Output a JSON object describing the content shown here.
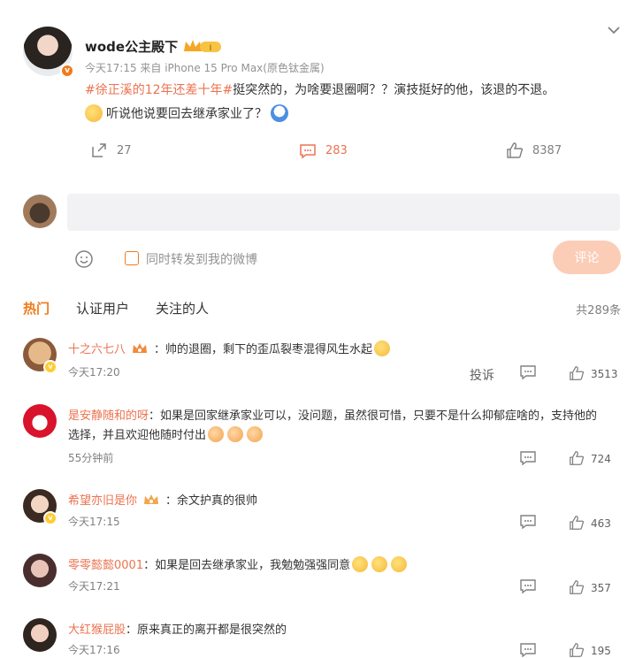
{
  "post": {
    "username": "wode公主殿下",
    "meta": "今天17:15  来自 iPhone 15 Pro Max(原色钛金属)",
    "hashtag": "#徐正溪的12年还差十年#",
    "text1": "挺突然的，为啥要退圈啊？？演技挺好的他，该退的不退。",
    "text2": "听说他说要回去继承家业了？",
    "reposts": "27",
    "comments": "283",
    "likes": "8387",
    "emojis": [
      "sleepy-emoji",
      "ghost-emoji"
    ]
  },
  "composer": {
    "placeholder": "",
    "forward_label": "同时转发到我的微博",
    "submit_label": "评论"
  },
  "tabs": {
    "items": [
      {
        "label": "热门",
        "active": true
      },
      {
        "label": "认证用户",
        "active": false
      },
      {
        "label": "关注的人",
        "active": false
      }
    ],
    "count": "共289条"
  },
  "comments": [
    {
      "name": "十之六七八",
      "text": "：帅的退圈，剩下的歪瓜裂枣混得风生水起",
      "time": "今天17:20",
      "report": "投诉",
      "likes": "3513"
    },
    {
      "name": "是安静随和的呀",
      "text": "：如果是回家继承家业可以，没问题，虽然很可惜，只要不是什么抑郁症啥的，支持他的",
      "text2": "选择，并且欢迎他随时付出",
      "time": "55分钟前",
      "likes": "724"
    },
    {
      "name": "希望亦旧是你",
      "text": "：余文护真的很帅",
      "time": "今天17:15",
      "likes": "463"
    },
    {
      "name": "零零懿懿0001",
      "text": "：如果是回去继承家业，我勉勉强强同意",
      "time": "今天17:21",
      "likes": "357"
    },
    {
      "name": "大红猴屁股",
      "text": "：原来真正的离开都是很突然的",
      "time": "今天17:16",
      "likes": "195"
    }
  ],
  "colors": {
    "accent": "#f07b1b",
    "link": "#eb7350",
    "submit_disabled": "#fbcdb7"
  }
}
